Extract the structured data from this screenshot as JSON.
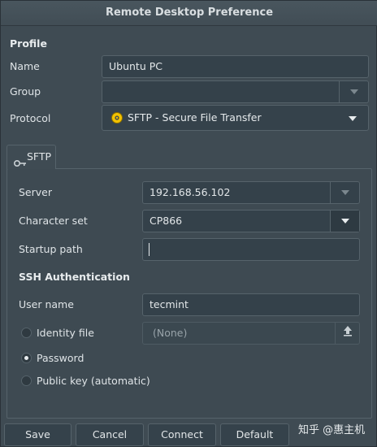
{
  "window": {
    "title": "Remote Desktop Preference"
  },
  "profile": {
    "section_title": "Profile",
    "name_label": "Name",
    "name_value": "Ubuntu PC",
    "group_label": "Group",
    "group_value": "",
    "protocol_label": "Protocol",
    "protocol_value": "SFTP - Secure File Transfer",
    "protocol_icon": "sftp-protocol-icon"
  },
  "tab": {
    "label": "SFTP",
    "icon": "key-icon"
  },
  "sftp": {
    "server_label": "Server",
    "server_value": "192.168.56.102",
    "charset_label": "Character set",
    "charset_value": "CP866",
    "startup_label": "Startup path",
    "startup_value": "",
    "ssh_section_title": "SSH Authentication",
    "username_label": "User name",
    "username_value": "tecmint",
    "identity_label": "Identity file",
    "identity_value": "(None)",
    "password_label": "Password",
    "publickey_label": "Public key (automatic)",
    "selected_auth": "Password"
  },
  "buttons": {
    "save": "Save",
    "cancel": "Cancel",
    "connect": "Connect",
    "default": "Default"
  },
  "watermark": {
    "text": "知乎 @惠主机"
  },
  "colors": {
    "window_bg": "#3f4b53",
    "field_bg": "#34414a",
    "border": "#56636b",
    "text": "#e4e8ea",
    "protocol_icon_yellow": "#f2c200"
  }
}
